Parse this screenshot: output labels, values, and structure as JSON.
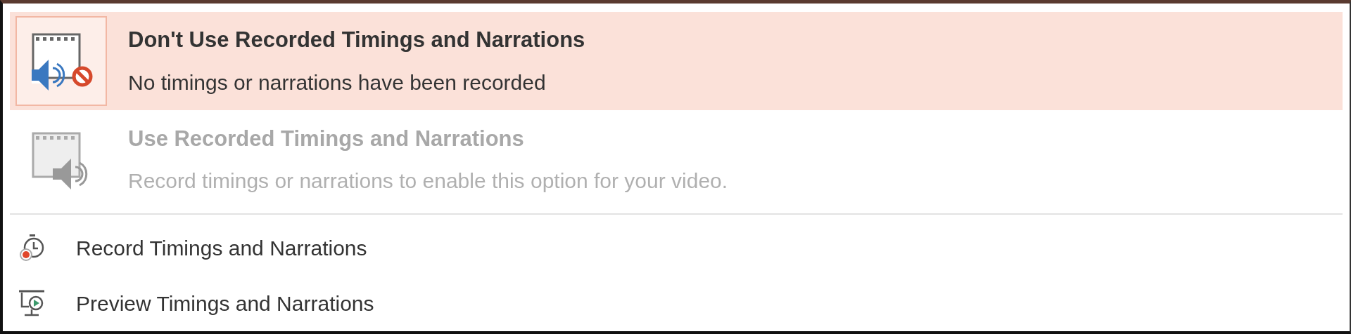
{
  "menu": {
    "items": [
      {
        "kind": "large",
        "title": "Don't Use Recorded Timings and Narrations",
        "description": "No timings or narrations have been recorded",
        "selected": true,
        "disabled": false
      },
      {
        "kind": "large",
        "title": "Use Recorded Timings and Narrations",
        "description": "Record timings or narrations to enable this option for your video.",
        "selected": false,
        "disabled": true
      },
      {
        "kind": "small",
        "title": "Record Timings and Narrations",
        "selected": false,
        "disabled": false
      },
      {
        "kind": "small",
        "title": "Preview Timings and Narrations",
        "selected": false,
        "disabled": false
      }
    ]
  }
}
